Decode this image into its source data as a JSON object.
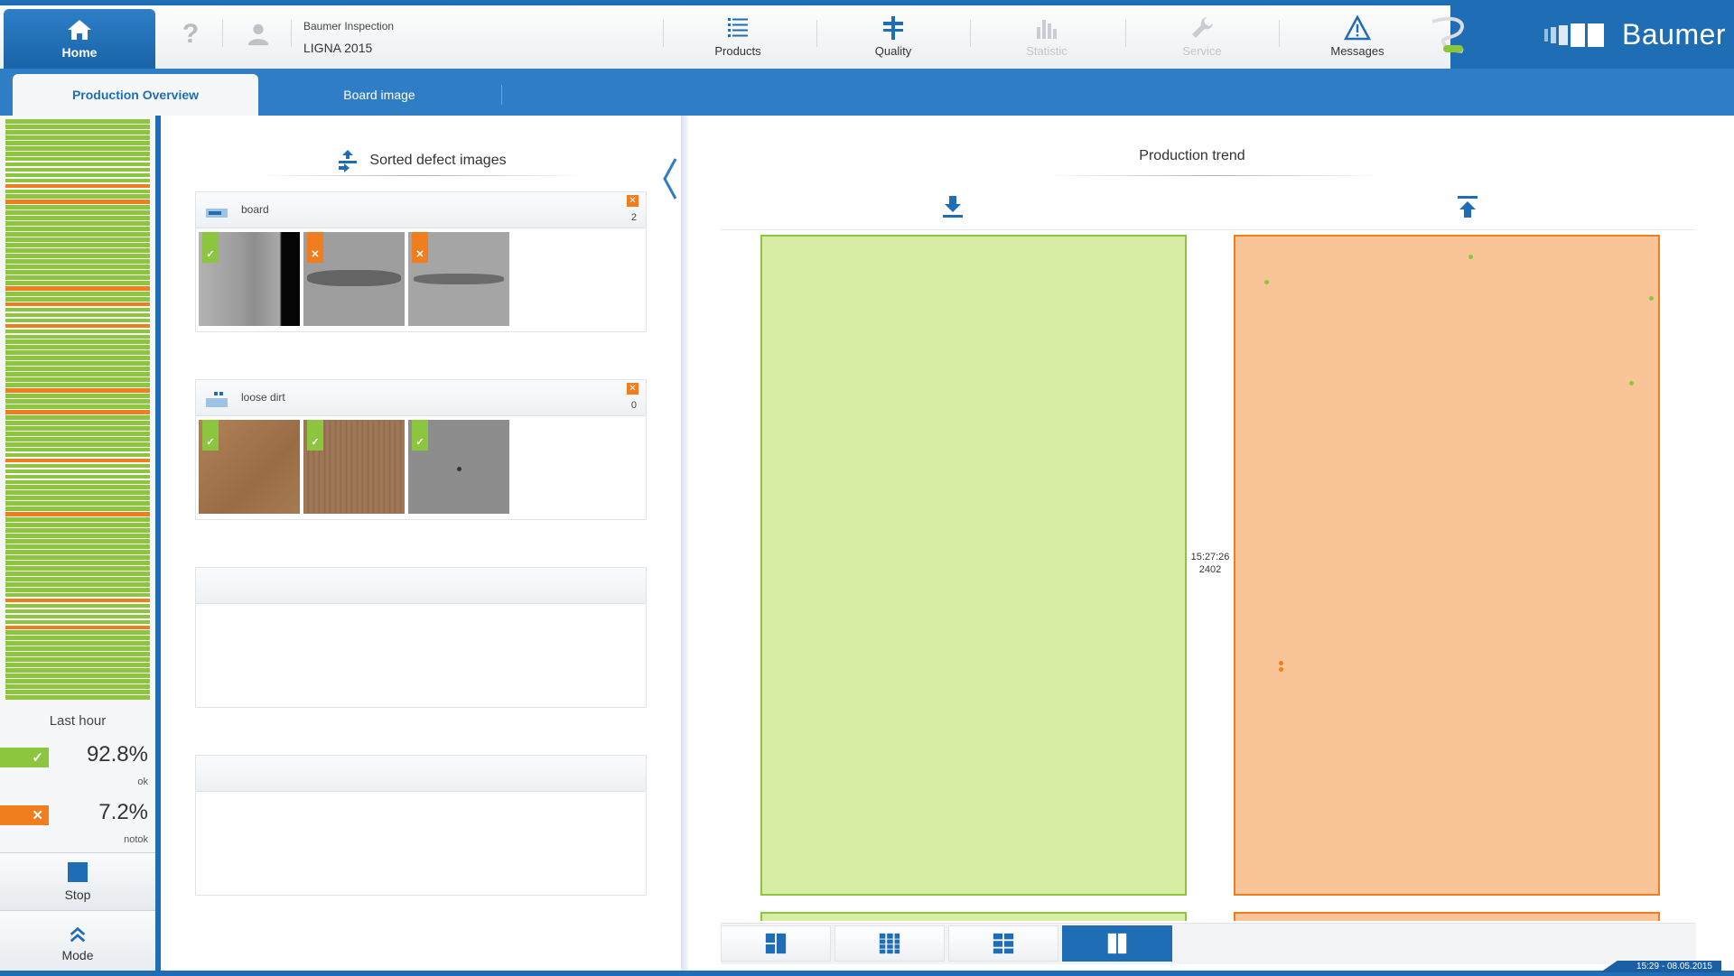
{
  "header": {
    "home_label": "Home",
    "help_glyph": "?",
    "app_name": "Baumer Inspection",
    "project": "LIGNA 2015",
    "nav": [
      {
        "label": "Products",
        "icon": "list-icon",
        "enabled": true
      },
      {
        "label": "Quality",
        "icon": "quality-icon",
        "enabled": true
      },
      {
        "label": "Statistic",
        "icon": "bar-chart-icon",
        "enabled": false
      },
      {
        "label": "Service",
        "icon": "wrench-icon",
        "enabled": false
      },
      {
        "label": "Messages",
        "icon": "warning-icon",
        "enabled": true
      }
    ],
    "brand": "Baumer"
  },
  "tabs": [
    {
      "label": "Production Overview",
      "active": true
    },
    {
      "label": "Board image",
      "active": false
    }
  ],
  "sidebar": {
    "strip_pattern": [
      "ok",
      "ok",
      "ok",
      "ok",
      "ok",
      "ok",
      "ok",
      "ok",
      "ok",
      "ok",
      "ok",
      "ok",
      "nok",
      "ok",
      "ok",
      "nok",
      "ok",
      "ok",
      "ok",
      "ok",
      "ok",
      "ok",
      "ok",
      "ok",
      "ok",
      "ok",
      "ok",
      "ok",
      "ok",
      "ok",
      "ok",
      "nok",
      "ok",
      "ok",
      "nok",
      "ok",
      "ok",
      "ok",
      "nok",
      "ok",
      "ok",
      "ok",
      "ok",
      "ok",
      "ok",
      "ok",
      "ok",
      "ok",
      "ok",
      "ok",
      "nok",
      "ok",
      "ok",
      "ok",
      "nok",
      "ok",
      "ok",
      "ok",
      "ok",
      "ok",
      "ok",
      "ok",
      "ok",
      "nok",
      "ok",
      "ok",
      "ok",
      "ok",
      "ok",
      "ok",
      "ok",
      "ok",
      "ok",
      "nok",
      "ok",
      "ok",
      "ok",
      "ok",
      "ok",
      "ok",
      "ok",
      "ok",
      "ok",
      "ok",
      "ok",
      "ok",
      "ok",
      "ok",
      "ok",
      "nok",
      "ok",
      "ok",
      "ok",
      "ok",
      "nok",
      "ok",
      "ok",
      "ok",
      "ok",
      "ok",
      "ok",
      "ok",
      "ok",
      "ok",
      "ok",
      "ok",
      "ok",
      "ok"
    ],
    "last_hour_label": "Last hour",
    "ok": {
      "value": "92.8%",
      "unit": "ok"
    },
    "notok": {
      "value": "7.2%",
      "unit": "notok"
    },
    "stop_label": "Stop",
    "mode_label": "Mode"
  },
  "defects": {
    "title": "Sorted defect images",
    "cards": [
      {
        "label": "board",
        "count": "2",
        "thumbs": [
          {
            "status": "ok",
            "tone": "#a9a9a9"
          },
          {
            "status": "nok",
            "tone": "#9a9a9a"
          },
          {
            "status": "nok",
            "tone": "#a3a3a3"
          }
        ]
      },
      {
        "label": "loose dirt",
        "count": "0",
        "thumbs": [
          {
            "status": "ok",
            "tone": "#a6774f"
          },
          {
            "status": "ok",
            "tone": "#9a7453"
          },
          {
            "status": "ok",
            "tone": "#8c8c8c"
          }
        ]
      }
    ]
  },
  "trend": {
    "title": "Production trend",
    "time": "15:27:26",
    "count": "2402"
  },
  "view_modes": [
    {
      "icon": "layout-split-icon",
      "active": false
    },
    {
      "icon": "layout-columns-icon",
      "active": false
    },
    {
      "icon": "layout-grid-icon",
      "active": false
    },
    {
      "icon": "layout-two-columns-icon",
      "active": true
    }
  ],
  "status": {
    "clock": "15:29 - 08.05.2015"
  },
  "colors": {
    "brand_blue": "#1f6db5",
    "ok_green": "#8cc63f",
    "nok_orange": "#f07d1e"
  }
}
